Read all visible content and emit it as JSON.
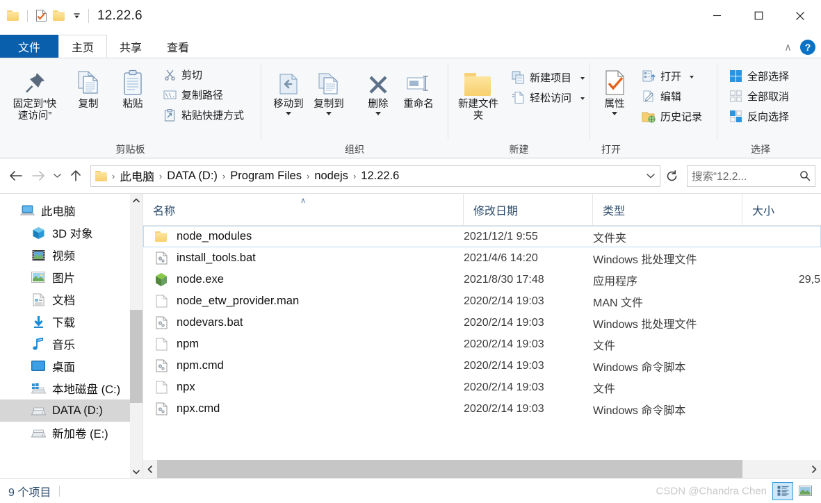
{
  "window": {
    "title": "12.22.6",
    "quick_access": [
      "folder-icon",
      "properties-icon",
      "new-folder-icon",
      "customize-dropdown-icon"
    ],
    "controls": {
      "minimize": "—",
      "maximize": "□",
      "close": "✕"
    }
  },
  "tabs": [
    {
      "label": "文件",
      "id": "file",
      "style": "file"
    },
    {
      "label": "主页",
      "id": "home",
      "style": "active"
    },
    {
      "label": "共享",
      "id": "share",
      "style": "normal"
    },
    {
      "label": "查看",
      "id": "view",
      "style": "normal"
    }
  ],
  "ribbon": {
    "collapse_label": "∧",
    "help_label": "?",
    "groups": [
      {
        "title": "剪贴板",
        "big_buttons": [
          {
            "label": "固定到“快速访问”",
            "icon": "pin-icon"
          },
          {
            "label": "复制",
            "icon": "copy-icon"
          },
          {
            "label": "粘贴",
            "icon": "paste-icon"
          }
        ],
        "small_buttons": [
          {
            "label": "剪切",
            "icon": "scissors-icon"
          },
          {
            "label": "复制路径",
            "icon": "copy-path-icon"
          },
          {
            "label": "粘贴快捷方式",
            "icon": "paste-shortcut-icon"
          }
        ]
      },
      {
        "title": "组织",
        "big_buttons": [
          {
            "label": "移动到",
            "icon": "move-to-icon",
            "dropdown": true
          },
          {
            "label": "复制到",
            "icon": "copy-to-icon",
            "dropdown": true
          },
          {
            "label": "删除",
            "icon": "delete-x-icon",
            "dropdown": true
          },
          {
            "label": "重命名",
            "icon": "rename-icon"
          }
        ],
        "small_buttons": []
      },
      {
        "title": "新建",
        "big_buttons": [
          {
            "label": "新建文件夹",
            "icon": "new-folder-icon"
          }
        ],
        "small_buttons": [
          {
            "label": "新建项目",
            "icon": "new-item-icon",
            "dropdown": true
          },
          {
            "label": "轻松访问",
            "icon": "easy-access-icon",
            "dropdown": true
          }
        ]
      },
      {
        "title": "打开",
        "big_buttons": [
          {
            "label": "属性",
            "icon": "properties-check-icon",
            "dropdown": true
          }
        ],
        "small_buttons": [
          {
            "label": "打开",
            "icon": "open-icon",
            "dropdown": true
          },
          {
            "label": "编辑",
            "icon": "edit-pencil-icon"
          },
          {
            "label": "历史记录",
            "icon": "history-icon"
          }
        ]
      },
      {
        "title": "选择",
        "big_buttons": [],
        "small_buttons": [
          {
            "label": "全部选择",
            "icon": "select-all-icon"
          },
          {
            "label": "全部取消",
            "icon": "select-none-icon"
          },
          {
            "label": "反向选择",
            "icon": "invert-selection-icon"
          }
        ]
      }
    ]
  },
  "address": {
    "back": "←",
    "forward": "→",
    "recent": "∨",
    "up": "↑",
    "breadcrumbs": [
      "此电脑",
      "DATA (D:)",
      "Program Files",
      "nodejs",
      "12.22.6"
    ],
    "separator": "›",
    "dropdown": "∨",
    "refresh": "↻"
  },
  "search": {
    "placeholder": "搜索“12.2...",
    "icon": "search-icon"
  },
  "sidebar": {
    "items": [
      {
        "label": "此电脑",
        "icon": "this-pc-icon",
        "indent": false,
        "selected": false
      },
      {
        "label": "3D 对象",
        "icon": "3d-objects-icon",
        "indent": true,
        "selected": false
      },
      {
        "label": "视频",
        "icon": "videos-icon",
        "indent": true,
        "selected": false
      },
      {
        "label": "图片",
        "icon": "pictures-icon",
        "indent": true,
        "selected": false
      },
      {
        "label": "文档",
        "icon": "documents-icon",
        "indent": true,
        "selected": false
      },
      {
        "label": "下载",
        "icon": "downloads-icon",
        "indent": true,
        "selected": false
      },
      {
        "label": "音乐",
        "icon": "music-icon",
        "indent": true,
        "selected": false
      },
      {
        "label": "桌面",
        "icon": "desktop-icon",
        "indent": true,
        "selected": false
      },
      {
        "label": "本地磁盘 (C:)",
        "icon": "system-drive-icon",
        "indent": true,
        "selected": false
      },
      {
        "label": "DATA (D:)",
        "icon": "drive-icon",
        "indent": true,
        "selected": true
      },
      {
        "label": "新加卷 (E:)",
        "icon": "drive-icon",
        "indent": true,
        "selected": false
      }
    ],
    "scroll_up": "∧",
    "scroll_down": "∨"
  },
  "filelist": {
    "columns": [
      {
        "label": "名称",
        "key": "name",
        "sorted": true,
        "sort_glyph": "∧"
      },
      {
        "label": "修改日期",
        "key": "date",
        "sorted": false
      },
      {
        "label": "类型",
        "key": "type",
        "sorted": false
      },
      {
        "label": "大小",
        "key": "size",
        "sorted": false
      }
    ],
    "rows": [
      {
        "name": "node_modules",
        "date": "2021/12/1 9:55",
        "type": "文件夹",
        "size": "",
        "icon": "folder-icon",
        "focused": true
      },
      {
        "name": "install_tools.bat",
        "date": "2021/4/6 14:20",
        "type": "Windows 批处理文件",
        "size": "",
        "icon": "bat-file-icon",
        "focused": false
      },
      {
        "name": "node.exe",
        "date": "2021/8/30 17:48",
        "type": "应用程序",
        "size": "29,5",
        "icon": "nodejs-exe-icon",
        "focused": false
      },
      {
        "name": "node_etw_provider.man",
        "date": "2020/2/14 19:03",
        "type": "MAN 文件",
        "size": "",
        "icon": "generic-file-icon",
        "focused": false
      },
      {
        "name": "nodevars.bat",
        "date": "2020/2/14 19:03",
        "type": "Windows 批处理文件",
        "size": "",
        "icon": "bat-file-icon",
        "focused": false
      },
      {
        "name": "npm",
        "date": "2020/2/14 19:03",
        "type": "文件",
        "size": "",
        "icon": "generic-file-icon",
        "focused": false
      },
      {
        "name": "npm.cmd",
        "date": "2020/2/14 19:03",
        "type": "Windows 命令脚本",
        "size": "",
        "icon": "cmd-file-icon",
        "focused": false
      },
      {
        "name": "npx",
        "date": "2020/2/14 19:03",
        "type": "文件",
        "size": "",
        "icon": "generic-file-icon",
        "focused": false
      },
      {
        "name": "npx.cmd",
        "date": "2020/2/14 19:03",
        "type": "Windows 命令脚本",
        "size": "",
        "icon": "cmd-file-icon",
        "focused": false
      }
    ],
    "hscroll_left": "‹",
    "hscroll_right": "›"
  },
  "statusbar": {
    "item_count": "9 个项目",
    "watermark": "CSDN @Chandra Chen",
    "views": [
      {
        "name": "details-view",
        "active": true
      },
      {
        "name": "large-icons-view",
        "active": false
      }
    ]
  },
  "colors": {
    "file_tab_blue": "#0a5fad",
    "accent_blue": "#0a72c4",
    "ribbon_bg": "#f7f8fa",
    "selection_gray": "#d6d6d6",
    "focus_border": "#bcdcf5",
    "header_text": "#2a4a6a"
  }
}
